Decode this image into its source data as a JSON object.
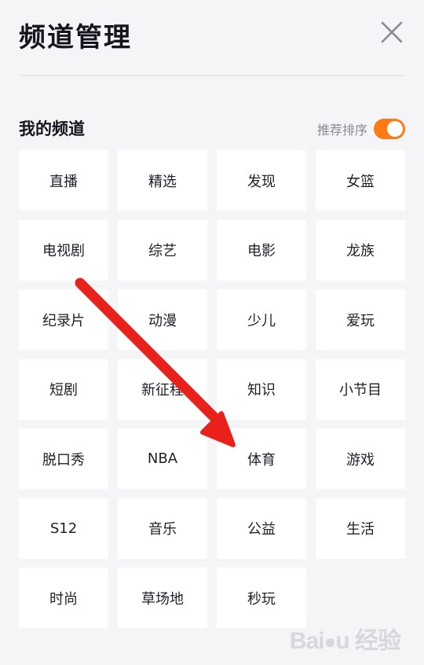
{
  "header": {
    "title": "频道管理",
    "close_icon": "close-icon"
  },
  "my_channels": {
    "title": "我的频道",
    "sort_label": "推荐排序",
    "sort_toggle_on": true,
    "accent_color": "#ff7a14"
  },
  "channels": [
    "直播",
    "精选",
    "发现",
    "女篮",
    "电视剧",
    "综艺",
    "电影",
    "龙族",
    "纪录片",
    "动漫",
    "少儿",
    "爱玩",
    "短剧",
    "新征程",
    "知识",
    "小节目",
    "脱口秀",
    "NBA",
    "体育",
    "游戏",
    "S12",
    "音乐",
    "公益",
    "生活",
    "时尚",
    "草场地",
    "秒玩"
  ],
  "annotation": {
    "arrow_color": "#e8221b",
    "points_to": "体育"
  },
  "watermark": {
    "logo": "Baidu 经验"
  }
}
